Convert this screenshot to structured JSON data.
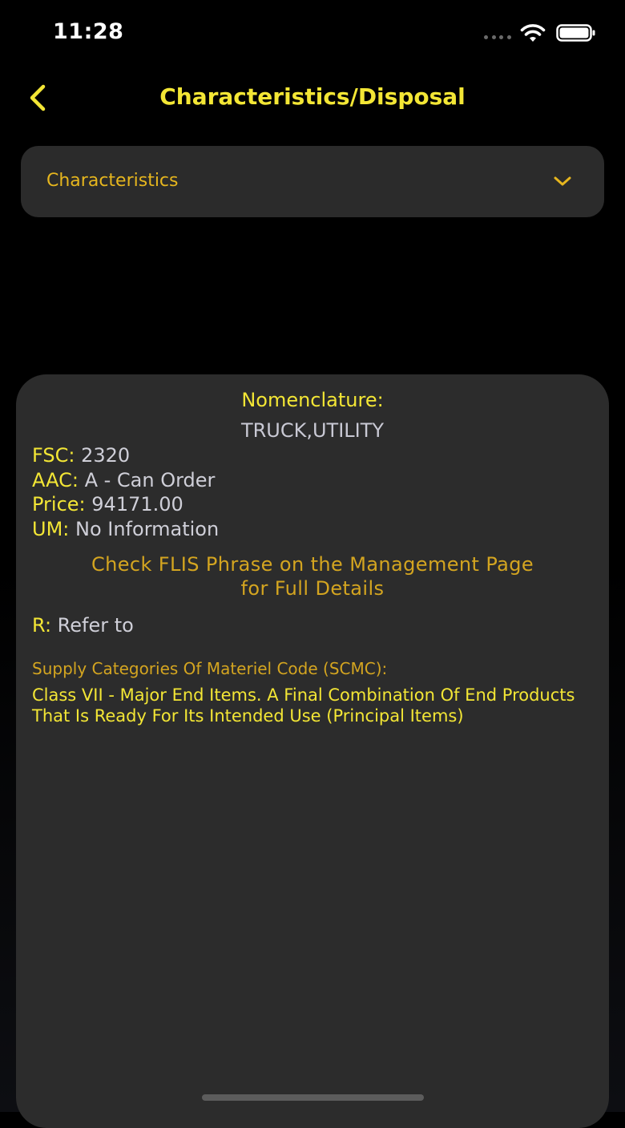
{
  "status_bar": {
    "time": "11:28",
    "icons": [
      "signal-dots-icon",
      "wifi-icon",
      "battery-icon"
    ]
  },
  "nav": {
    "back_icon": "chevron-left-icon",
    "title": "Characteristics/Disposal"
  },
  "dropdown": {
    "selected": "Characteristics",
    "icon": "chevron-down-icon"
  },
  "card": {
    "nomenclature_label": "Nomenclature:",
    "nomenclature_value": "TRUCK,UTILITY",
    "fields": [
      {
        "key": "FSC:",
        "value": "2320"
      },
      {
        "key": "AAC:",
        "value": "A - Can Order"
      },
      {
        "key": "Price:",
        "value": "94171.00"
      },
      {
        "key": "UM:",
        "value": "No Information"
      }
    ],
    "flis_note_line1": "Check FLIS Phrase on the Management Page",
    "flis_note_line2": "for Full Details",
    "r_key": "R:",
    "r_value": "Refer to",
    "scmc_heading": "Supply Categories Of Materiel Code (SCMC):",
    "scmc_value": "Class VII - Major End Items.  A Final Combination Of End Products That Is Ready For Its Intended Use (Principal Items)"
  },
  "colors": {
    "accent_yellow": "#f3e635",
    "gold": "#d4a520",
    "card_bg": "#2c2c2c",
    "background": "#000000"
  }
}
